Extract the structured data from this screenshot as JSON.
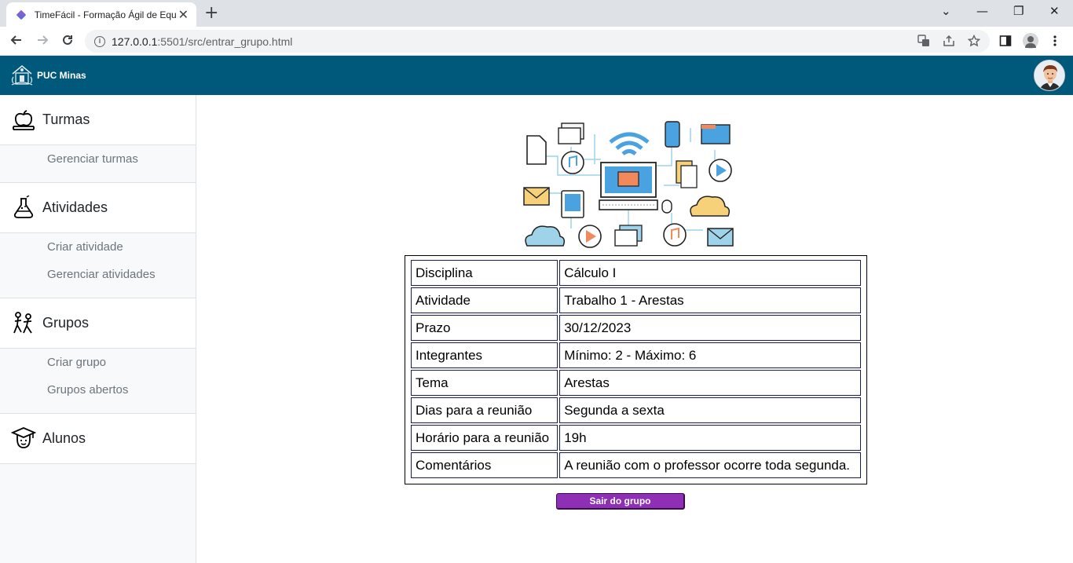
{
  "browser": {
    "tab_title": "TimeFácil - Formação Ágil de Equ",
    "tab_close": "✕",
    "new_tab": "+",
    "url_host": "127.0.0.1",
    "url_path": ":5501/src/entrar_grupo.html",
    "window_controls": [
      "⌄",
      "—",
      "❐",
      "✕"
    ]
  },
  "app": {
    "brand": "PUC Minas"
  },
  "sidebar": {
    "sections": [
      {
        "label": "Turmas",
        "icon": "apple-book-icon",
        "links": [
          "Gerenciar turmas"
        ]
      },
      {
        "label": "Atividades",
        "icon": "flask-icon",
        "links": [
          "Criar atividade",
          "Gerenciar atividades"
        ]
      },
      {
        "label": "Grupos",
        "icon": "group-walking-icon",
        "links": [
          "Criar grupo",
          "Grupos abertos"
        ]
      },
      {
        "label": "Alunos",
        "icon": "graduate-icon",
        "links": []
      }
    ]
  },
  "details": {
    "rows": [
      {
        "key": "Disciplina",
        "value": "Cálculo I"
      },
      {
        "key": "Atividade",
        "value": "Trabalho 1 - Arestas"
      },
      {
        "key": "Prazo",
        "value": "30/12/2023"
      },
      {
        "key": "Integrantes",
        "value": "Mínimo: 2 - Máximo: 6"
      },
      {
        "key": "Tema",
        "value": "Arestas"
      },
      {
        "key": "Dias para a reunião",
        "value": "Segunda a sexta"
      },
      {
        "key": "Horário para a reunião",
        "value": "19h"
      },
      {
        "key": "Comentários",
        "value": "A reunião com o professor ocorre toda segunda."
      }
    ]
  },
  "actions": {
    "leave_label": "Sair do grupo"
  },
  "colors": {
    "appbar": "#00587a",
    "button": "#8e2fb5"
  }
}
